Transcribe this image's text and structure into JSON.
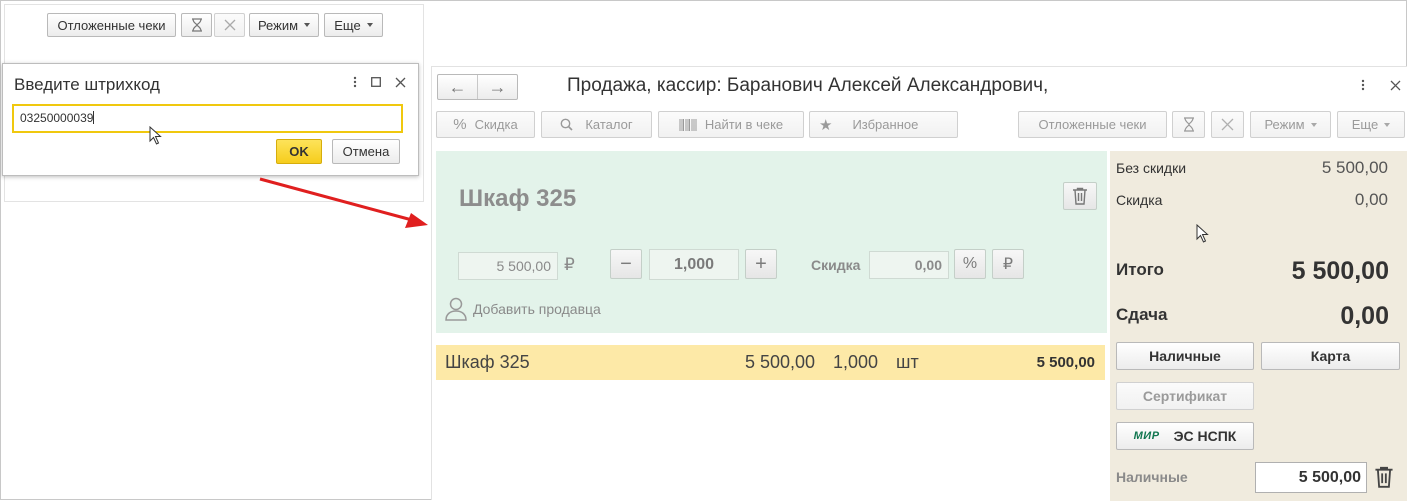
{
  "background_toolbar": {
    "deferred_label": "Отложенные чеки",
    "mode_label": "Режим",
    "more_label": "Еще"
  },
  "dialog": {
    "title": "Введите штрихкод",
    "barcode_value": "03250000039",
    "ok_label": "OK",
    "cancel_label": "Отмена"
  },
  "sale_window": {
    "title": "Продажа, кассир: Баранович Алексей Александрович,",
    "toolbar": {
      "discount_label": "Скидка",
      "catalog_label": "Каталог",
      "find_label": "Найти в чеке",
      "favorites_label": "Избранное",
      "deferred_label": "Отложенные чеки",
      "mode_label": "Режим",
      "more_label": "Еще"
    },
    "item": {
      "name": "Шкаф 325",
      "price": "5 500,00",
      "currency": "₽",
      "quantity": "1,000",
      "discount_label": "Скидка",
      "discount_value": "0,00",
      "add_seller_label": "Добавить продавца"
    },
    "receipt_rows": [
      {
        "name": "Шкаф 325",
        "price": "5 500,00",
        "qty": "1,000",
        "unit": "шт",
        "sum": "5 500,00"
      }
    ],
    "totals": {
      "no_discount_label": "Без скидки",
      "no_discount_value": "5 500,00",
      "discount_label": "Скидка",
      "discount_value": "0,00",
      "total_label": "Итого",
      "total_value": "5 500,00",
      "change_label": "Сдача",
      "change_value": "0,00"
    },
    "payment": {
      "cash_label": "Наличные",
      "card_label": "Карта",
      "certificate_label": "Сертификат",
      "mir_logo": "МИР",
      "nspk_label": "ЭС НСПК",
      "cash_row_label": "Наличные",
      "cash_row_value": "5 500,00"
    }
  },
  "colors": {
    "accent_yellow": "#f6cd1c",
    "selected_row": "#fde9a7",
    "item_panel": "#e3f3ea",
    "totals_panel": "#f0ebde",
    "arrow_red": "#e01f1f"
  }
}
